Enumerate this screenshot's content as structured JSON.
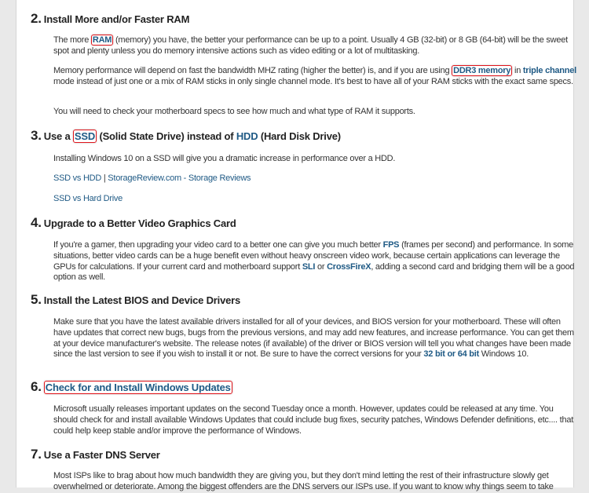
{
  "sections": [
    {
      "num": "2.",
      "title": "Install More and/or Faster RAM",
      "p1": {
        "a": "The more ",
        "link": "RAM",
        "b": " (memory) you have, the better your performance can be up to a point. Usually 4 GB (32-bit) or 8 GB (64-bit) will be the sweet spot and plenty unless you do memory intensive actions such as video editing or a lot of multitasking."
      },
      "p2": {
        "a": "Memory performance will depend on fast the bandwidth MHZ rating (higher the better) is, and if you are using ",
        "link1": "DDR3 memory",
        "b": " in ",
        "link2": "triple channel",
        "c": " mode instead of just one or a mix of RAM sticks in only single channel mode. It's best to have all of your RAM sticks with the exact same specs."
      },
      "p3": "You will need to check your motherboard specs to see how much and what type of RAM it supports."
    },
    {
      "num": "3.",
      "t1": "Use a ",
      "link1": "SSD",
      "t2": " (Solid State Drive) instead of ",
      "link2": "HDD",
      "t3": " (Hard Disk Drive)",
      "p1": "Installing Windows 10 on a SSD will give you a dramatic increase in performance over a HDD.",
      "l1": "SSD vs HDD",
      "sep": " | ",
      "l2": "StorageReview.com - Storage Reviews",
      "l3": "SSD vs Hard Drive"
    },
    {
      "num": "4.",
      "title": "Upgrade to a Better Video Graphics Card",
      "p": {
        "a": "If you're a gamer, then upgrading your video card to a better one can give you much better ",
        "link1": "FPS",
        "b": " (frames per second) and performance. In some situations, better video cards can be a huge benefit even without heavy onscreen video work, because certain applications can leverage the GPUs for calculations. If your current card and motherboard support ",
        "link2": "SLI",
        "c": " or ",
        "link3": "CrossFireX",
        "d": ", adding a second card and bridging them will be a good option as well."
      }
    },
    {
      "num": "5.",
      "title": "Install the Latest BIOS and Device Drivers",
      "p": {
        "a": "Make sure that you have the latest available drivers installed for all of your devices, and BIOS version for your motherboard. These will often have updates that correct new bugs, bugs from the previous versions, and may add new features, and increase performance. You can get them at your device manufacturer's website. The release notes (if available) of the driver or BIOS version will tell you what changes have been made since the last version to see if you wish to install it or not. Be sure to have the correct versions for your ",
        "link": "32 bit or 64 bit",
        "b": " Windows 10."
      }
    },
    {
      "num": "6.",
      "title": "Check for and Install Windows Updates",
      "p": "Microsoft usually releases important updates on the second Tuesday once a month. However, updates could be released at any time. You should check for and install available Windows Updates that could include bug fixes, security patches, Windows Defender definitions, etc.... that could help keep stable and/or improve the performance of Windows."
    },
    {
      "num": "7.",
      "title": "Use a Faster DNS Server",
      "p": "Most ISPs like to brag about how much bandwidth they are giving you, but they don't mind letting the rest of their infrastructure slowly get overwhelmed or deteriorate. Among the biggest offenders are the DNS servers our ISPs use. If you want to know why things seem to take"
    }
  ],
  "colors": {
    "link": "#1f5a85",
    "highlight_box": "#e0141b",
    "background": "#e9e9e9"
  }
}
